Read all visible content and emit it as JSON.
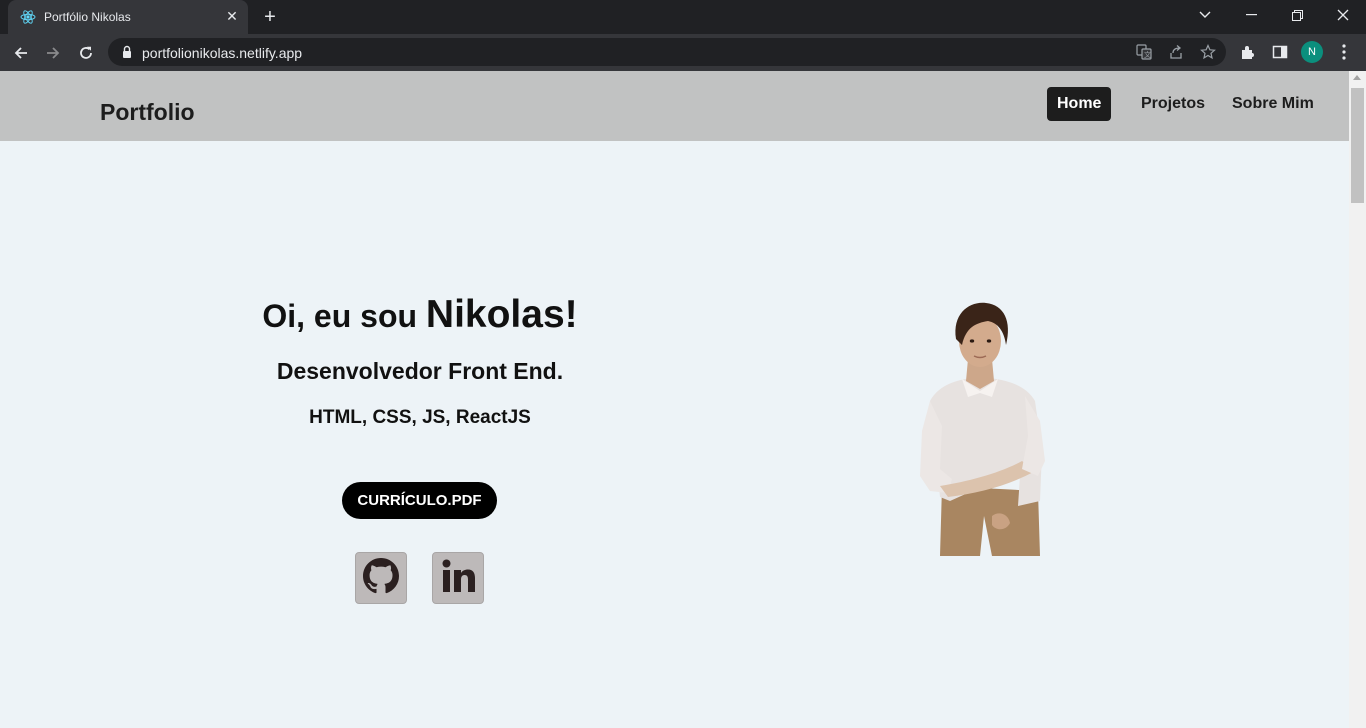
{
  "browser": {
    "tab_title": "Portfólio Nikolas",
    "url": "portfolionikolas.netlify.app",
    "profile_initial": "N"
  },
  "site": {
    "logo": "Portfolio",
    "nav": [
      {
        "label": "Home",
        "active": true
      },
      {
        "label": "Projetos",
        "active": false
      },
      {
        "label": "Sobre Mim",
        "active": false
      }
    ]
  },
  "hero": {
    "greeting": "Oi, eu sou ",
    "name": "Nikolas!",
    "role": "Desenvolvedor Front End.",
    "skills": "HTML, CSS, JS, ReactJS",
    "cv_button": "CURRÍCULO.PDF",
    "social_icons": [
      "github-icon",
      "linkedin-icon"
    ]
  },
  "colors": {
    "header_bg": "#c1c2c2",
    "page_bg": "#edf3f7",
    "active_nav_bg": "#1d1d1d",
    "button_bg": "#000000"
  }
}
